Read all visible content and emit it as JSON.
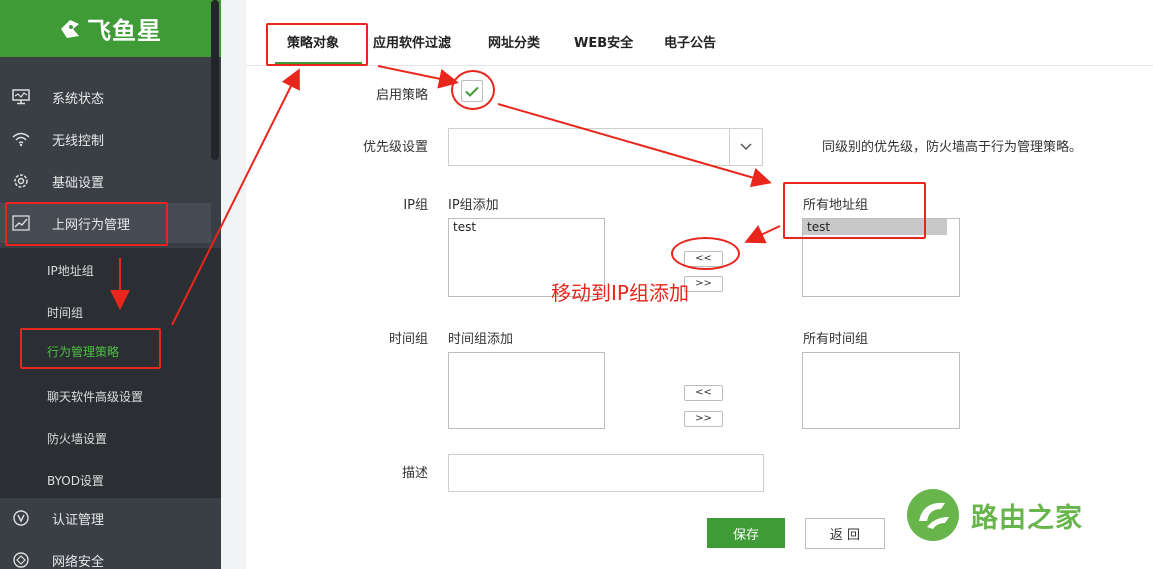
{
  "brand": {
    "name": "飞鱼星"
  },
  "sidebar": {
    "items": [
      {
        "label": "系统状态",
        "icon": "monitor-icon"
      },
      {
        "label": "无线控制",
        "icon": "wifi-icon"
      },
      {
        "label": "基础设置",
        "icon": "gear-icon"
      },
      {
        "label": "上网行为管理",
        "icon": "chart-icon"
      }
    ],
    "sub_items": [
      {
        "label": "IP地址组"
      },
      {
        "label": "时间组"
      },
      {
        "label": "行为管理策略"
      },
      {
        "label": "聊天软件高级设置"
      },
      {
        "label": "防火墙设置"
      },
      {
        "label": "BYOD设置"
      }
    ],
    "bottom_items": [
      {
        "label": "认证管理",
        "icon": "v-circle-icon"
      },
      {
        "label": "网络安全",
        "icon": "shield-icon"
      }
    ]
  },
  "tabs": [
    {
      "label": "策略对象"
    },
    {
      "label": "应用软件过滤"
    },
    {
      "label": "网址分类"
    },
    {
      "label": "WEB安全"
    },
    {
      "label": "电子公告"
    }
  ],
  "form": {
    "enable_label": "启用策略",
    "enable_checked": true,
    "priority_label": "优先级设置",
    "priority_value": "",
    "priority_hint": "同级别的优先级，防火墙高于行为管理策略。",
    "ip_group_label": "IP组",
    "ip_added_label": "IP组添加",
    "ip_added_options": [
      "test"
    ],
    "all_addr_label": "所有地址组",
    "all_addr_options": [
      "test"
    ],
    "move_left": "<<",
    "move_right": ">>",
    "time_group_label": "时间组",
    "time_added_label": "时间组添加",
    "all_time_label": "所有时间组",
    "desc_label": "描述",
    "desc_value": "",
    "save_label": "保存",
    "back_label": "返 回"
  },
  "annotation": {
    "text": "移动到IP组添加"
  },
  "watermark": {
    "text": "路由之家"
  },
  "colors": {
    "accent": "#3f9b36",
    "annotation": "#e8261c",
    "sidebar": "#3a3e45"
  }
}
